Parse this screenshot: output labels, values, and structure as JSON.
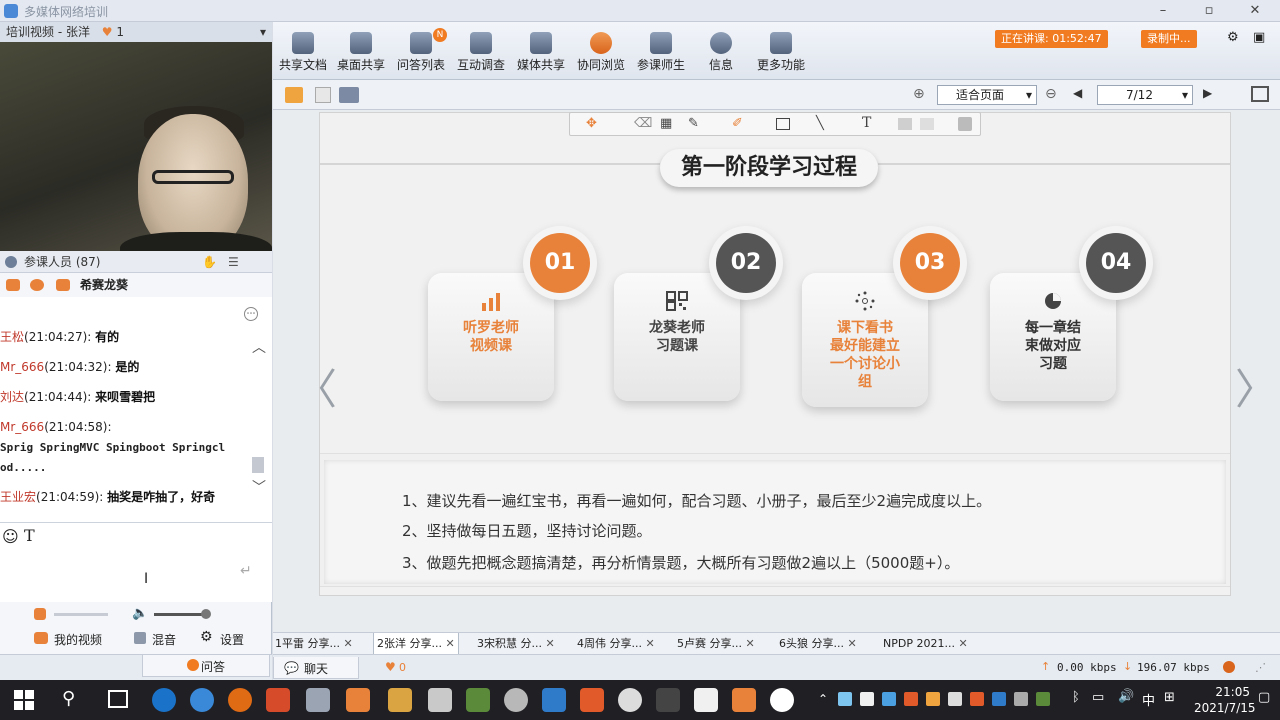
{
  "window": {
    "title": "多媒体网络培训",
    "min": "–",
    "max": "▫",
    "close": "✕"
  },
  "left": {
    "video_title": "培训视频 - 张洋",
    "video_count": "1",
    "participants": "参课人员 (87)",
    "presenter": "希赛龙葵",
    "messages": [
      {
        "who": "王松",
        "time": "(21:04:27):",
        "text": "有的"
      },
      {
        "who": "Mr_666",
        "time": "(21:04:32):",
        "text": "是的"
      },
      {
        "who": "刘达",
        "time": "(21:04:44):",
        "text": "来呗雪碧把"
      },
      {
        "who": "Mr_666",
        "time": "(21:04:58):",
        "text": ""
      },
      {
        "who": "",
        "time": "",
        "text": "Sprig SpringMVC Spingboot Springcl"
      },
      {
        "who": "",
        "time": "",
        "text": "od....."
      },
      {
        "who": "王业宏",
        "time": "(21:04:59):",
        "text": "抽奖是咋抽了，好奇"
      }
    ],
    "text_tool": "T",
    "my_video": "我的视频",
    "mix": "混音",
    "settings": "设置",
    "qa_tab": "问答",
    "chat_tab": "聊天",
    "likes": "0"
  },
  "toolbar": {
    "items": [
      "共享文档",
      "桌面共享",
      "问答列表",
      "互动调查",
      "媒体共享",
      "协同浏览",
      "参课师生",
      "信息",
      "更多功能"
    ],
    "qa_badge": "N",
    "live_status": "正在讲课: 01:52:47",
    "recording": "录制中..."
  },
  "doc_toolbar": {
    "fit": "适合页面",
    "page": "7/12"
  },
  "slide": {
    "title": "第一阶段学习过程",
    "steps": [
      {
        "num": "01",
        "text": [
          "听罗老师",
          "视频课"
        ],
        "color": "#e8823a"
      },
      {
        "num": "02",
        "text": [
          "龙葵老师",
          "习题课"
        ],
        "color": "#555555"
      },
      {
        "num": "03",
        "text": [
          "课下看书",
          "最好能建立",
          "一个讨论小",
          "组"
        ],
        "color": "#e8823a"
      },
      {
        "num": "04",
        "text": [
          "每一章结",
          "束做对应",
          "习题"
        ],
        "color": "#555555"
      }
    ],
    "notes": [
      "1、建议先看一遍红宝书，再看一遍如何，配合习题、小册子，最后至少2遍完成度以上。",
      "2、坚持做每日五题，坚持讨论问题。",
      "3、做题先把概念题搞清楚，再分析情景题，大概所有习题做2遍以上（5000题+）。"
    ],
    "prev": "〈",
    "next": "〉"
  },
  "doc_tabs": [
    "1平雷 分享...",
    "2张洋 分享...",
    "3宋积慧 分...",
    "4周伟 分享...",
    "5卢赛 分享...",
    "6头狼 分享...",
    "NPDP 2021..."
  ],
  "status": {
    "up": "0.00 kbps",
    "down": "196.07 kbps"
  },
  "taskbar": {
    "time": "21:05",
    "date": "2021/7/15",
    "ime": "中"
  }
}
